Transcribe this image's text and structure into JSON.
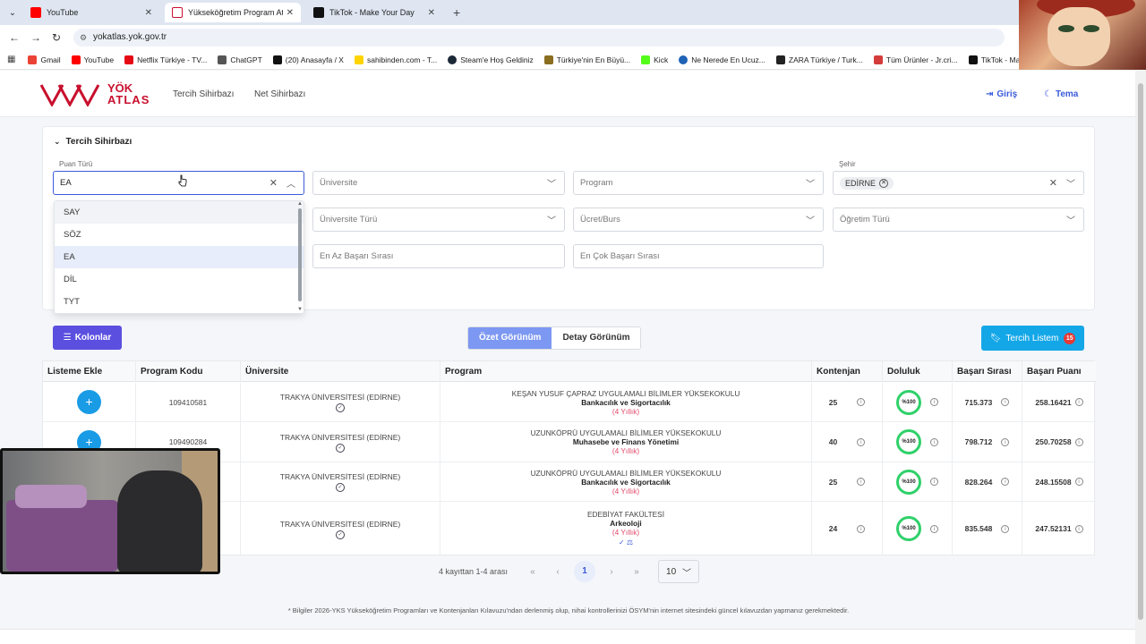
{
  "browser": {
    "tabs": [
      {
        "title": "YouTube",
        "fav_color": "#ff0000",
        "active": false
      },
      {
        "title": "Yükseköğretim Program Atlası",
        "fav_color": "#c8102e",
        "active": true
      },
      {
        "title": "TikTok - Make Your Day",
        "fav_color": "#111111",
        "active": false
      }
    ],
    "url": "yokatlas.yok.gov.tr",
    "bookmarks": [
      {
        "label": "Gmail",
        "color": "#ea4335"
      },
      {
        "label": "YouTube",
        "color": "#ff0000"
      },
      {
        "label": "Netflix Türkiye - TV...",
        "color": "#e50914"
      },
      {
        "label": "ChatGPT",
        "color": "#555555"
      },
      {
        "label": "(20) Anasayfa / X",
        "color": "#111111"
      },
      {
        "label": "sahibinden.com - T...",
        "color": "#ffd400"
      },
      {
        "label": "Steam'e Hoş Geldiniz",
        "color": "#1b2838"
      },
      {
        "label": "Türkiye'nin En Büyü...",
        "color": "#8a6d1f"
      },
      {
        "label": "Kick",
        "color": "#53fc18"
      },
      {
        "label": "Ne Nerede En Ucuz...",
        "color": "#1e63b5"
      },
      {
        "label": "ZARA Türkiye / Turk...",
        "color": "#222222"
      },
      {
        "label": "Tüm Ürünler - Jr.cri...",
        "color": "#d43c3c"
      },
      {
        "label": "TikTok - Make Your...",
        "color": "#111111"
      }
    ]
  },
  "header": {
    "logo_line1": "YÖK",
    "logo_line2": "ATLAS",
    "nav": [
      "Tercih Sihirbazı",
      "Net Sihirbazı"
    ],
    "login": "Giriş",
    "theme": "Tema"
  },
  "filters": {
    "section_title": "Tercih Sihirbazı",
    "puan_turu_label": "Puan Türü",
    "puan_turu_value": "EA",
    "universite_placeholder": "Üniversite",
    "program_placeholder": "Program",
    "sehir_label": "Şehir",
    "sehir_chip": "EDİRNE",
    "universite_turu_placeholder": "Üniversite Türü",
    "ucret_placeholder": "Ücret/Burs",
    "ogretim_turu_placeholder": "Öğretim Türü",
    "en_az_placeholder": "En Az Başarı Sırası",
    "en_cok_placeholder": "En Çok Başarı Sırası",
    "dropdown_options": [
      "SAY",
      "SÖZ",
      "EA",
      "DİL",
      "TYT"
    ],
    "dropdown_selected": "EA"
  },
  "actions": {
    "kolonlar": "Kolonlar",
    "ozet": "Özet Görünüm",
    "detay": "Detay Görünüm",
    "tercih_listem": "Tercih Listem",
    "tercih_count": "15"
  },
  "table": {
    "headers": [
      "Listeme Ekle",
      "Program Kodu",
      "Üniversite",
      "Program",
      "Kontenjan",
      "Doluluk",
      "Başarı Sırası",
      "Başarı Puanı"
    ],
    "rows": [
      {
        "code": "109410581",
        "university": "TRAKYA ÜNİVERSİTESİ (EDİRNE)",
        "faculty": "KEŞAN YUSUF ÇAPRAZ UYGULAMALI BİLİMLER YÜKSEKOKULU",
        "program": "Bankacılık ve Sigortacılık",
        "duration": "(4 Yıllık)",
        "quota": "25",
        "fill": "%100",
        "rank": "715.373",
        "score": "258.16421"
      },
      {
        "code": "109490284",
        "university": "TRAKYA ÜNİVERSİTESİ (EDİRNE)",
        "faculty": "UZUNKÖPRÜ UYGULAMALI BİLİMLER YÜKSEKOKULU",
        "program": "Muhasebe ve Finans Yönetimi",
        "duration": "(4 Yıllık)",
        "quota": "40",
        "fill": "%100",
        "rank": "798.712",
        "score": "250.70258"
      },
      {
        "code": "",
        "university": "TRAKYA ÜNİVERSİTESİ (EDİRNE)",
        "faculty": "UZUNKÖPRÜ UYGULAMALI BİLİMLER YÜKSEKOKULU",
        "program": "Bankacılık ve Sigortacılık",
        "duration": "(4 Yıllık)",
        "quota": "25",
        "fill": "%100",
        "rank": "828.264",
        "score": "248.15508"
      },
      {
        "code": "",
        "university": "TRAKYA ÜNİVERSİTESİ (EDİRNE)",
        "faculty": "EDEBİYAT FAKÜLTESİ",
        "program": "Arkeoloji",
        "duration": "(4 Yıllık)",
        "quota": "24",
        "fill": "%100",
        "rank": "835.548",
        "score": "247.52131"
      }
    ]
  },
  "pagination": {
    "summary": "4 kayıttan 1-4 arası",
    "current_page": "1",
    "page_size": "10"
  },
  "footnote": "* Bilgiler 2026-YKS Yükseköğretim Programları ve Kontenjanları Kılavuzu'ndan derlenmiş olup, nihai kontrollerinizi ÖSYM'nin internet sitesindeki güncel kılavuzdan yapmanız gerekmektedir.",
  "colors": {
    "brand": "#c8102e",
    "primary": "#3b5bdb",
    "kolonlar_bg": "#5b4fe0",
    "tercih_bg": "#14a7e8",
    "fill_ring": "#2fd16a"
  }
}
